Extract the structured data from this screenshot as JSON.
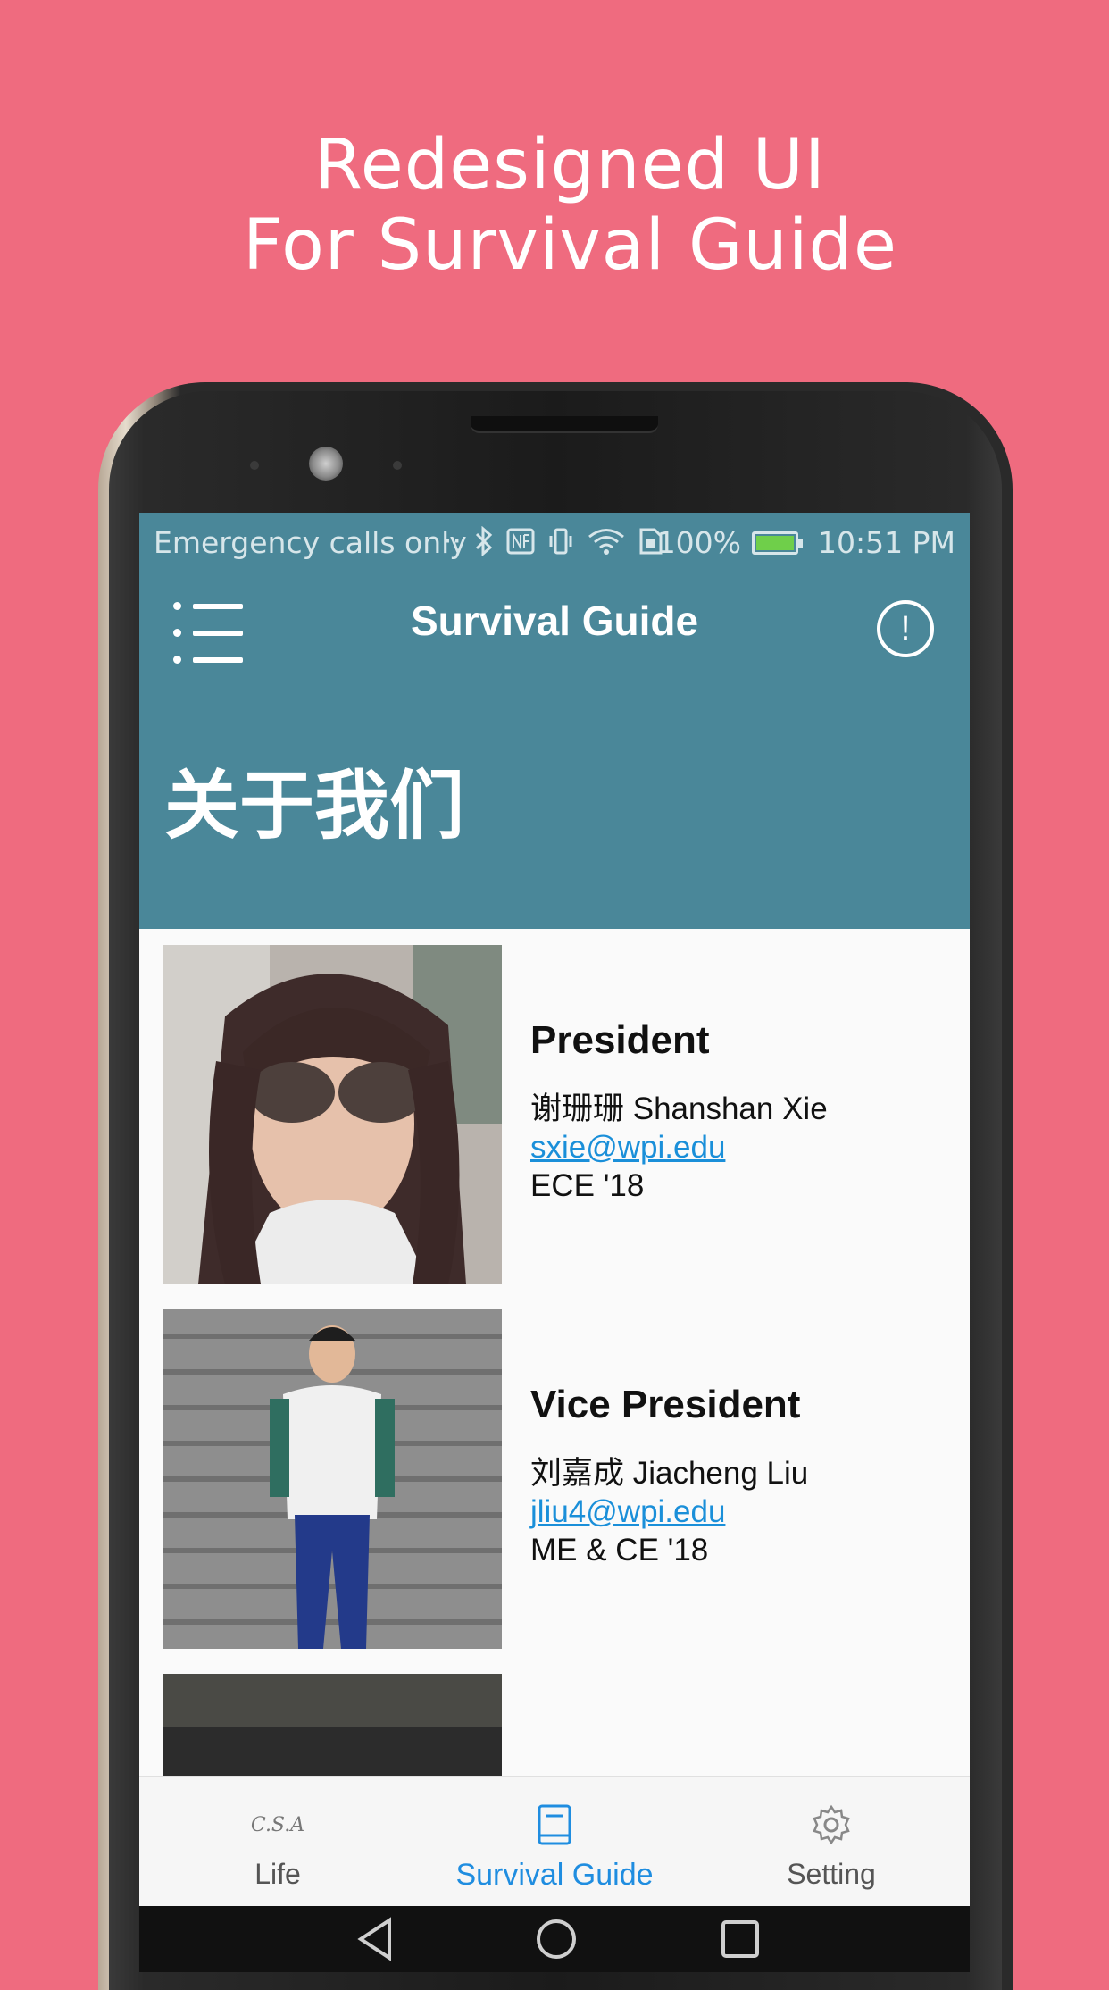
{
  "headline": {
    "line1": "Redesigned UI",
    "line2": "For Survival Guide"
  },
  "status_bar": {
    "carrier": "Emergency calls only",
    "icons": [
      "dots-icon",
      "bluetooth-icon",
      "nfc-icon",
      "vibrate-icon",
      "wifi-icon",
      "sim-icon"
    ],
    "battery": "100%",
    "battery_level": 1.0,
    "time": "10:51 PM"
  },
  "app_bar": {
    "title": "Survival Guide",
    "menu_icon": "menu-icon",
    "info_icon": "info-icon",
    "info_glyph": "!"
  },
  "page_heading": "关于我们",
  "members": [
    {
      "role": "President",
      "name": "谢珊珊 Shanshan Xie",
      "email": "sxie@wpi.edu",
      "major": "ECE '18"
    },
    {
      "role": "Vice President",
      "name": "刘嘉成 Jiacheng Liu",
      "email": "jliu4@wpi.edu",
      "major": "ME & CE '18"
    }
  ],
  "bottom_nav": {
    "items": [
      {
        "label": "Life",
        "icon": "csa-logo-icon",
        "logo_text": "C.S.A"
      },
      {
        "label": "Survival Guide",
        "icon": "book-icon",
        "active": true
      },
      {
        "label": "Setting",
        "icon": "gear-icon"
      }
    ]
  },
  "colors": {
    "background": "#ef6b7f",
    "app_bar": "#4a8799",
    "accent": "#1f8de0",
    "link": "#1a8fd9"
  }
}
